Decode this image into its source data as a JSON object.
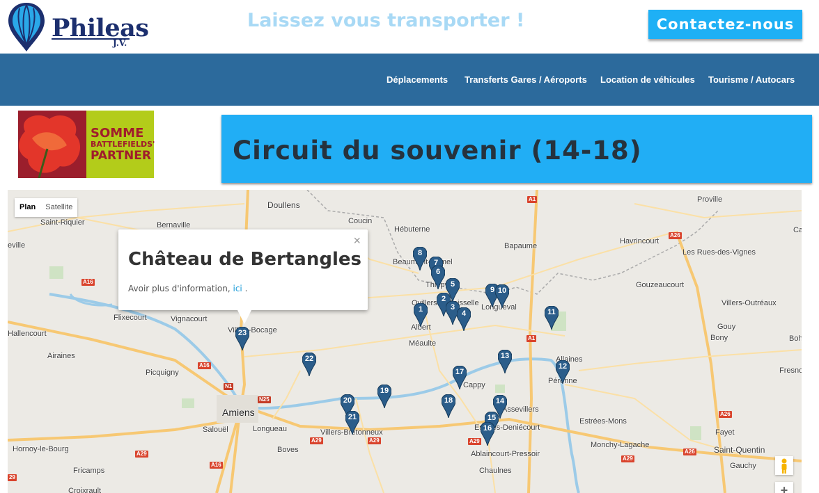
{
  "header": {
    "logo_text": "Phileas",
    "logo_sub": "J.V.",
    "tagline": "Laissez vous transporter !",
    "contact_label": "Contactez-nous"
  },
  "nav": {
    "items": [
      {
        "label": "Déplacements"
      },
      {
        "label": "Transferts Gares / Aéroports"
      },
      {
        "label": "Location de véhicules"
      },
      {
        "label": "Tourisme / Autocars"
      }
    ]
  },
  "badge": {
    "line1": "SOMME",
    "line2": "BATTLEFIELDS'",
    "line3": "PARTNER"
  },
  "page": {
    "title": "Circuit du souvenir (14-18)"
  },
  "map": {
    "type_plan": "Plan",
    "type_satellite": "Satellite",
    "popup": {
      "title": "Château de Bertangles",
      "text": "Avoir plus d'information,",
      "link": "ici",
      "after": ".",
      "close": "×"
    },
    "places": [
      "Doullens",
      "Saint-Riquier",
      "Bernaville",
      "Coucin",
      "Hébuterne",
      "Beaumont-Hamel",
      "Bapaume",
      "Havrincourt",
      "Les Rues-des-Vignes",
      "Proville",
      "Ca",
      "eville",
      "Thiepval",
      "Ovillers-la-Boisselle",
      "Longueval",
      "Gouzeaucourt",
      "Villers-Outréaux",
      "Flixecourt",
      "Vignacourt",
      "Villers-Bocage",
      "Albert",
      "Méaulte",
      "Gouy",
      "Bony",
      "Hallencourt",
      "Airaines",
      "Picquigny",
      "Allaines",
      "Péronne",
      "Cappy",
      "Boh",
      "Fresno",
      "Amiens",
      "Salouël",
      "Longueau",
      "Villers-Bretonneux",
      "Estrées-Mons",
      "Hornoy-le-Bourg",
      "Boves",
      "Estrées-Deniécourt",
      "Ablaincourt-Pressoir",
      "Monchy-Lagache",
      "Fayet",
      "Saint-Quentin",
      "Fricamps",
      "Chaulnes",
      "Gauchy",
      "Croixrault",
      "Assevillers"
    ],
    "roads": [
      "A1",
      "A1",
      "A26",
      "A16",
      "A16",
      "N1",
      "N25",
      "A29",
      "A29",
      "A29",
      "A29",
      "A16",
      "A26",
      "A29",
      "A26",
      "29"
    ],
    "markers": [
      "1",
      "2",
      "3",
      "4",
      "5",
      "6",
      "7",
      "8",
      "9",
      "10",
      "11",
      "12",
      "13",
      "14",
      "15",
      "16",
      "17",
      "18",
      "19",
      "20",
      "21",
      "22",
      "23"
    ],
    "marker_color": "#2b5d8a"
  },
  "colors": {
    "nav_bg": "#2c6a9c",
    "accent": "#21aef5",
    "tagline": "#a8d9f5",
    "logo": "#1c2f6e"
  }
}
